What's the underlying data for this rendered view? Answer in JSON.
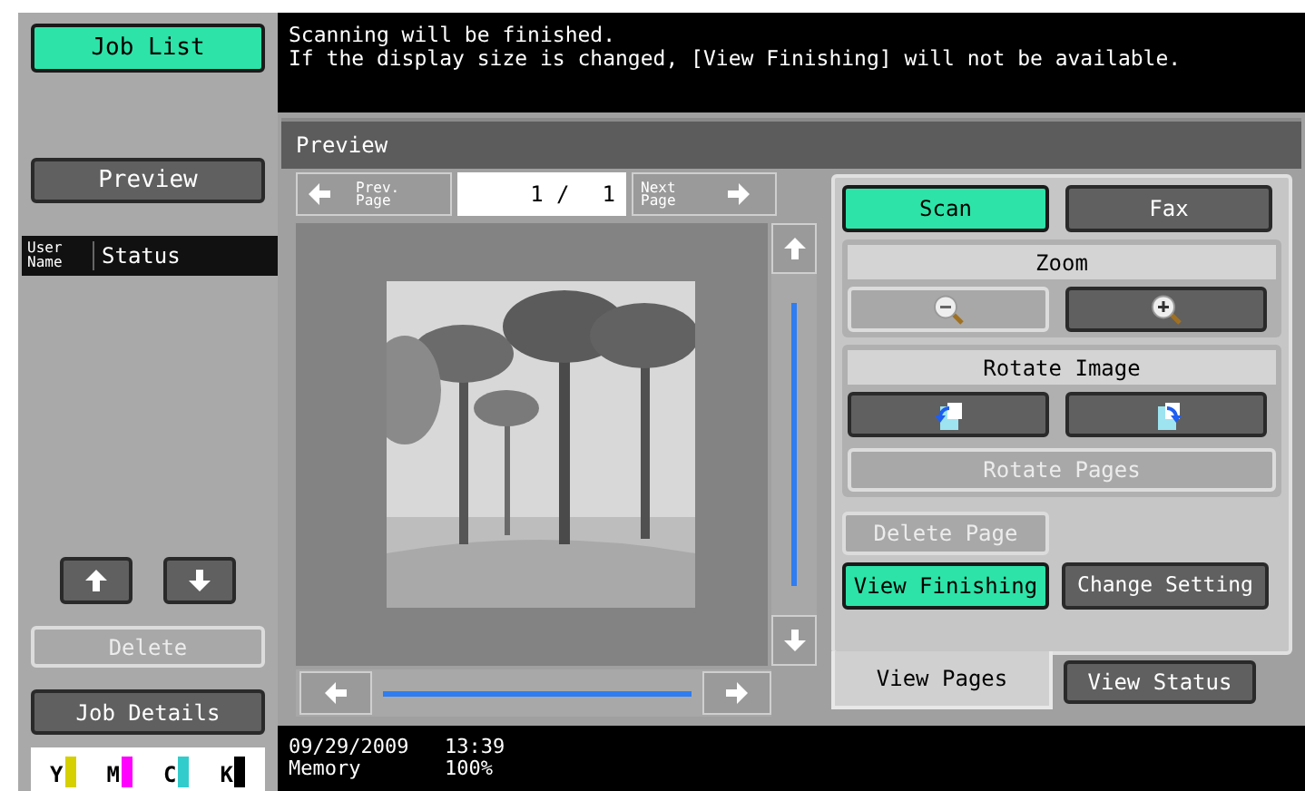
{
  "sidebar": {
    "job_list": {
      "label": "Job List",
      "selected": true
    },
    "preview_button": {
      "label": "Preview",
      "selected": false
    },
    "columns": [
      {
        "label": "User Name"
      },
      {
        "label": "Status"
      }
    ],
    "delete_button": {
      "label": "Delete",
      "disabled": true
    },
    "job_details": {
      "label": "Job Details"
    },
    "toner": [
      {
        "label": "Y",
        "color": "#d6d000"
      },
      {
        "label": "M",
        "color": "#ff00ff"
      },
      {
        "label": "C",
        "color": "#33cccc"
      },
      {
        "label": "K",
        "color": "#000000"
      }
    ]
  },
  "message": [
    "Scanning will be finished.",
    "If the display size is changed, [View Finishing] will not be available."
  ],
  "preview": {
    "title": "Preview",
    "prev_page": "Prev. Page",
    "page_current": "1 /",
    "page_total": "1",
    "next_page": "Next Page"
  },
  "mode_buttons": [
    {
      "label": "Scan",
      "selected": true
    },
    {
      "label": "Fax",
      "selected": false
    }
  ],
  "zoom": {
    "label": "Zoom",
    "buttons": [
      {
        "kind": "zoom-out",
        "disabled": true
      },
      {
        "kind": "zoom-in",
        "disabled": false
      }
    ]
  },
  "rotate": {
    "label": "Rotate Image",
    "buttons": [
      {
        "kind": "rotate-left"
      },
      {
        "kind": "rotate-right"
      }
    ]
  },
  "rotate_pages": {
    "label": "Rotate Pages",
    "disabled": true
  },
  "delete_page": {
    "label": "Delete Page",
    "disabled": true
  },
  "view_finishing": {
    "label": "View Finishing",
    "selected": true
  },
  "change_setting": {
    "label": "Change Setting",
    "selected": false
  },
  "tabs": [
    {
      "label": "View Pages",
      "selected": true
    },
    {
      "label": "View Status",
      "selected": false
    }
  ],
  "status_bar": {
    "date": "09/29/2009",
    "time": "13:39",
    "memory_label": "Memory",
    "memory_value": "100%"
  }
}
